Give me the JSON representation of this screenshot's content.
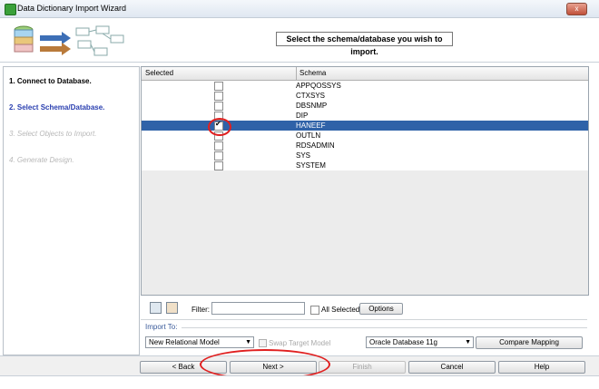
{
  "window": {
    "title": "Data Dictionary Import Wizard",
    "close_label": "x"
  },
  "header": {
    "instruction": "Select the schema/database you wish to import."
  },
  "steps": [
    {
      "label": "1. Connect to Database.",
      "state": "done"
    },
    {
      "label": "2. Select Schema/Database.",
      "state": "current"
    },
    {
      "label": "3. Select Objects to Import.",
      "state": "disabled"
    },
    {
      "label": "4. Generate Design.",
      "state": "disabled"
    }
  ],
  "table": {
    "columns": [
      "Selected",
      "Schema"
    ],
    "rows": [
      {
        "schema": "APPQOSSYS",
        "checked": false
      },
      {
        "schema": "CTXSYS",
        "checked": false
      },
      {
        "schema": "DBSNMP",
        "checked": false
      },
      {
        "schema": "DIP",
        "checked": false
      },
      {
        "schema": "HANEEF",
        "checked": true,
        "selected": true
      },
      {
        "schema": "OUTLN",
        "checked": false
      },
      {
        "schema": "RDSADMIN",
        "checked": false
      },
      {
        "schema": "SYS",
        "checked": false
      },
      {
        "schema": "SYSTEM",
        "checked": false
      }
    ]
  },
  "filter": {
    "label": "Filter:",
    "value": "",
    "all_selected_label": "All Selected",
    "options_label": "Options"
  },
  "import_to": {
    "label": "Import To:",
    "model": "New Relational Model",
    "swap_label": "Swap Target Model",
    "database": "Oracle Database 11g",
    "compare_label": "Compare Mapping"
  },
  "buttons": {
    "back": "< Back",
    "next": "Next >",
    "finish": "Finish",
    "cancel": "Cancel",
    "help": "Help"
  },
  "colors": {
    "selected_row": "#2f62a8",
    "current_step": "#2a3fb0",
    "annotation": "#e02020"
  }
}
